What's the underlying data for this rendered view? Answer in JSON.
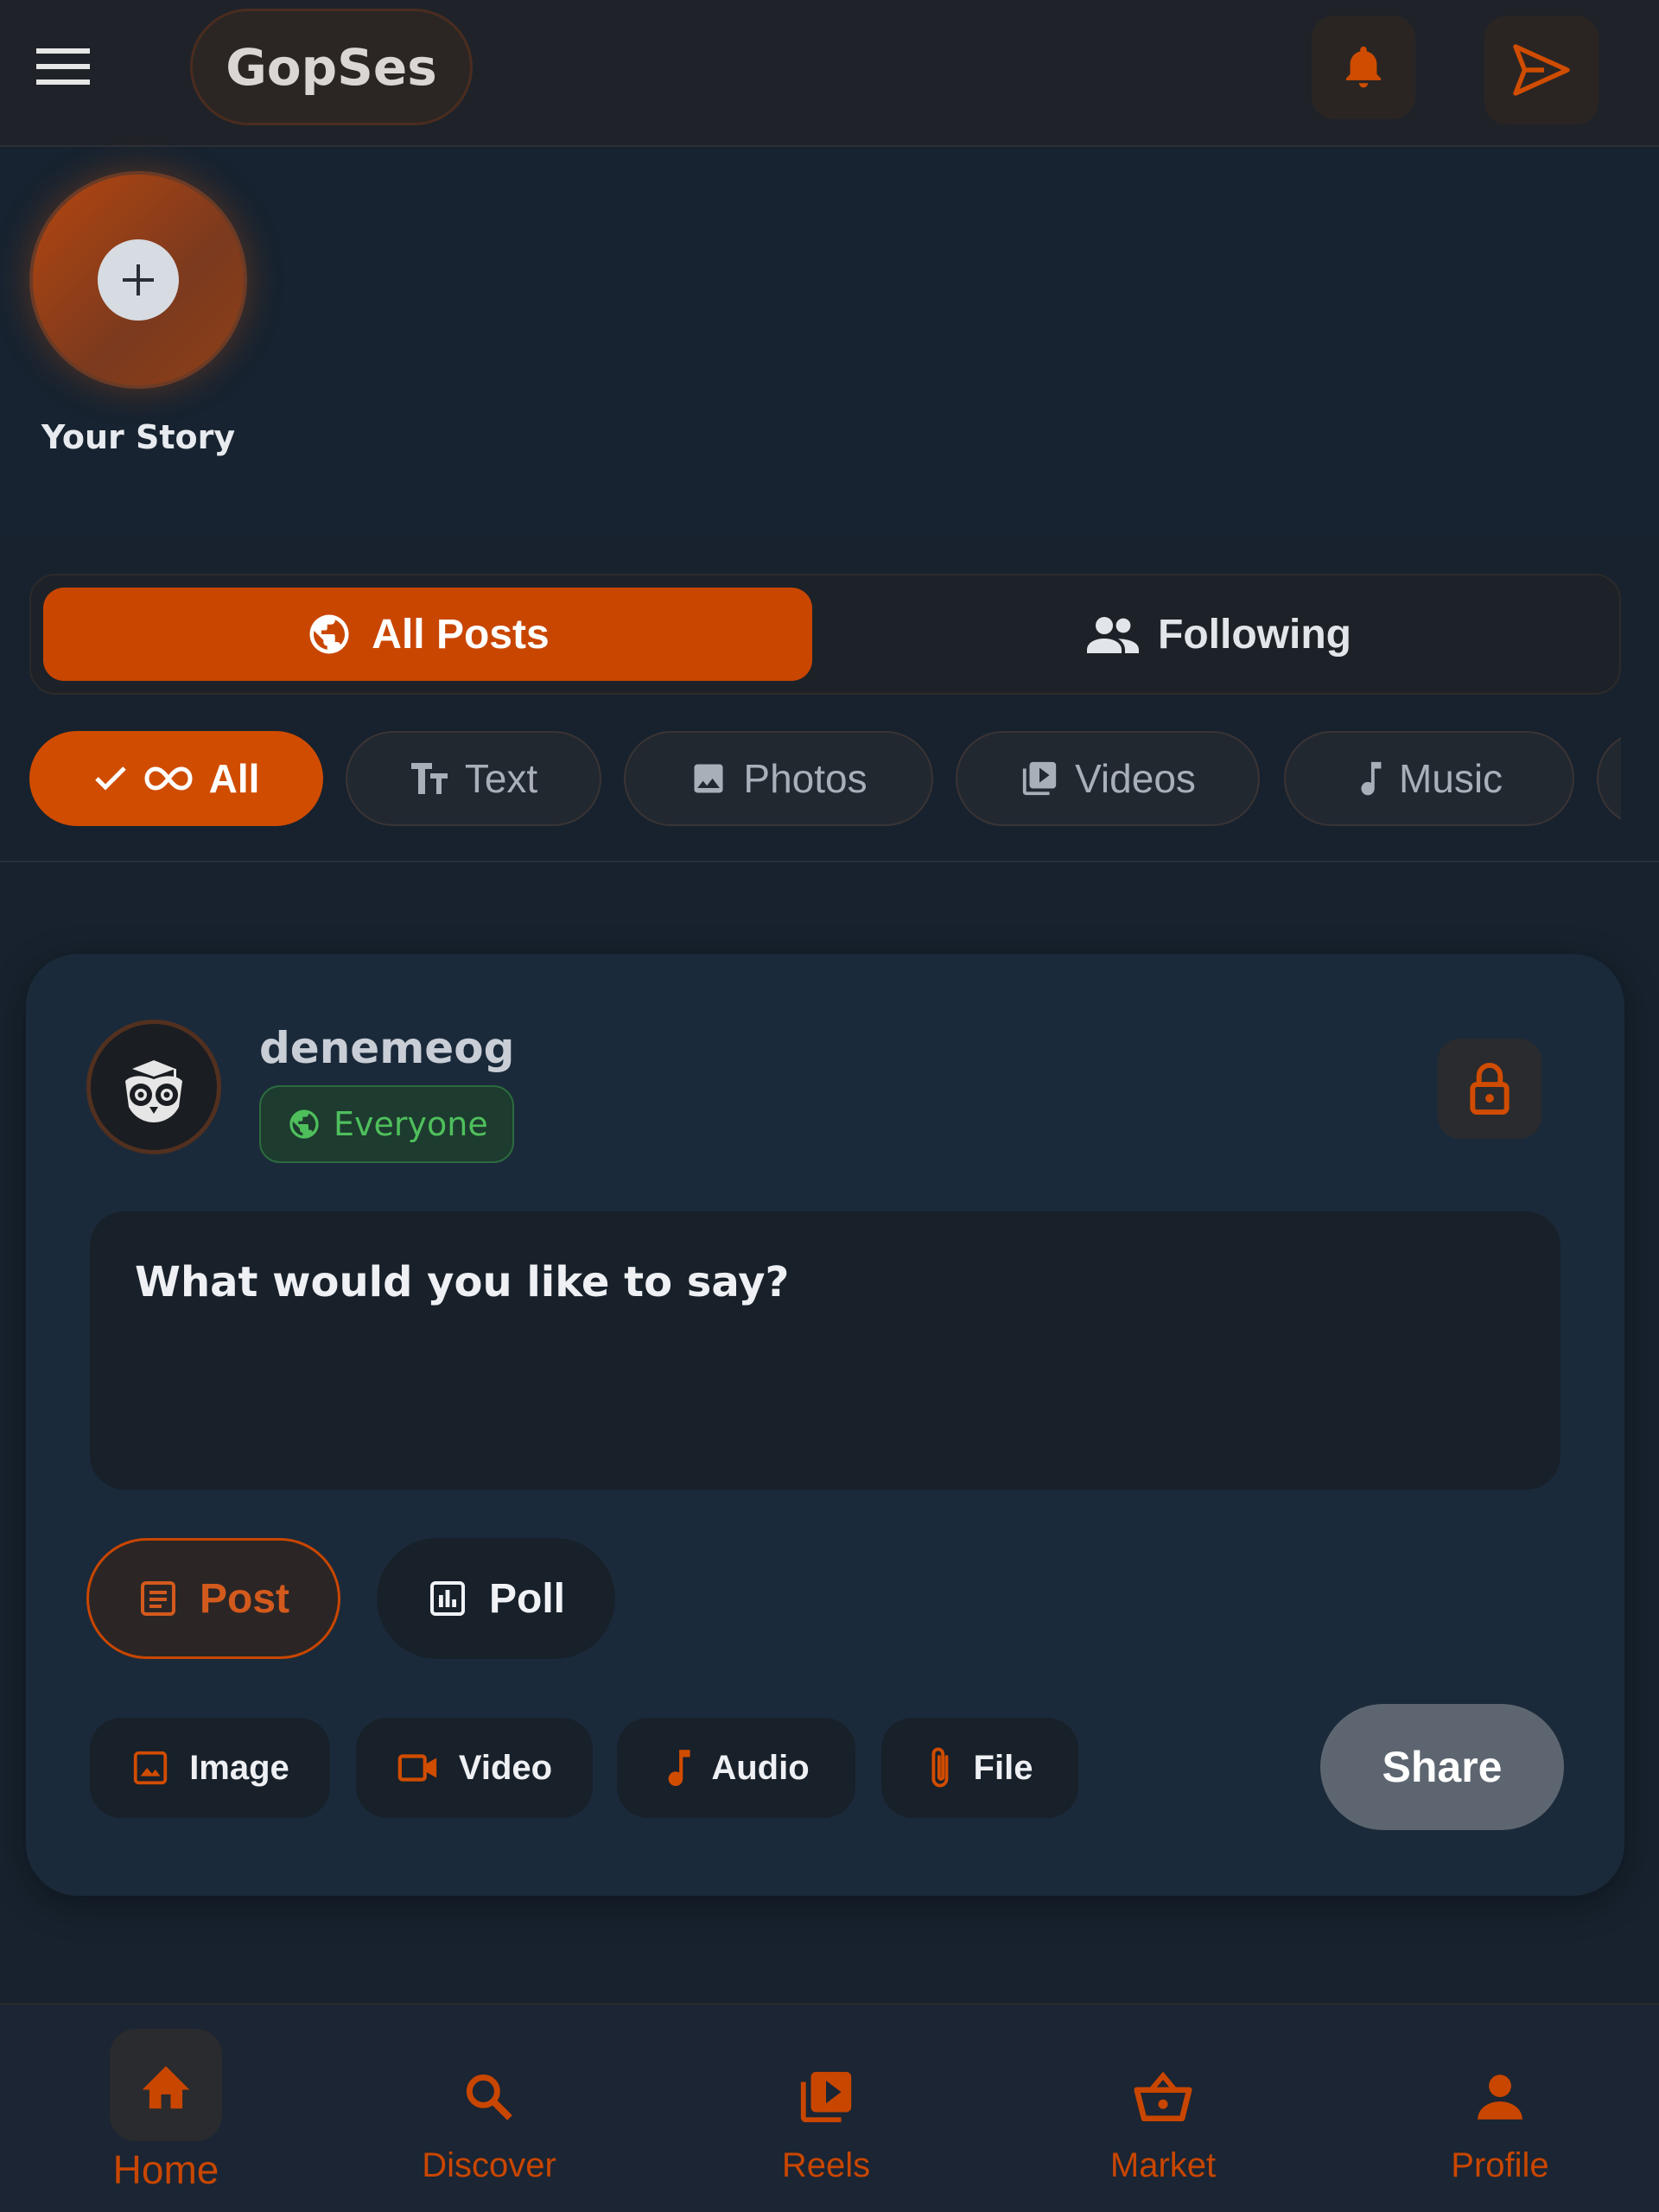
{
  "header": {
    "brand": "GopSes",
    "icons": {
      "menu": "menu-icon",
      "notifications": "bell-icon",
      "messages": "send-icon"
    }
  },
  "stories": {
    "items": [
      {
        "label": "Your Story",
        "icon": "plus-icon"
      }
    ]
  },
  "feed_toggle": {
    "options": [
      {
        "label": "All Posts",
        "icon": "globe-icon",
        "active": true
      },
      {
        "label": "Following",
        "icon": "people-icon",
        "active": false
      }
    ]
  },
  "filters": {
    "items": [
      {
        "label": "All",
        "icon": "infinity-icon",
        "active": true
      },
      {
        "label": "Text",
        "icon": "text-size-icon",
        "active": false
      },
      {
        "label": "Photos",
        "icon": "image-icon",
        "active": false
      },
      {
        "label": "Videos",
        "icon": "video-library-icon",
        "active": false
      },
      {
        "label": "Music",
        "icon": "music-note-icon",
        "active": false
      }
    ]
  },
  "composer": {
    "username": "denemeog",
    "visibility": "Everyone",
    "placeholder": "What would you like to say?",
    "types": [
      {
        "label": "Post",
        "icon": "article-icon",
        "active": true
      },
      {
        "label": "Poll",
        "icon": "poll-icon",
        "active": false
      }
    ],
    "attachments": [
      {
        "label": "Image",
        "icon": "image-icon"
      },
      {
        "label": "Video",
        "icon": "videocam-icon"
      },
      {
        "label": "Audio",
        "icon": "music-note-icon"
      },
      {
        "label": "File",
        "icon": "paperclip-icon"
      }
    ],
    "share_label": "Share"
  },
  "bottom_nav": {
    "items": [
      {
        "label": "Home",
        "icon": "home-icon",
        "active": true
      },
      {
        "label": "Discover",
        "icon": "search-icon",
        "active": false
      },
      {
        "label": "Reels",
        "icon": "reels-icon",
        "active": false
      },
      {
        "label": "Market",
        "icon": "basket-icon",
        "active": false
      },
      {
        "label": "Profile",
        "icon": "person-icon",
        "active": false
      }
    ]
  },
  "colors": {
    "accent": "#c94600",
    "background": "#17222e",
    "card": "#1b2a3a",
    "visibility_green": "#4fbf5c"
  }
}
